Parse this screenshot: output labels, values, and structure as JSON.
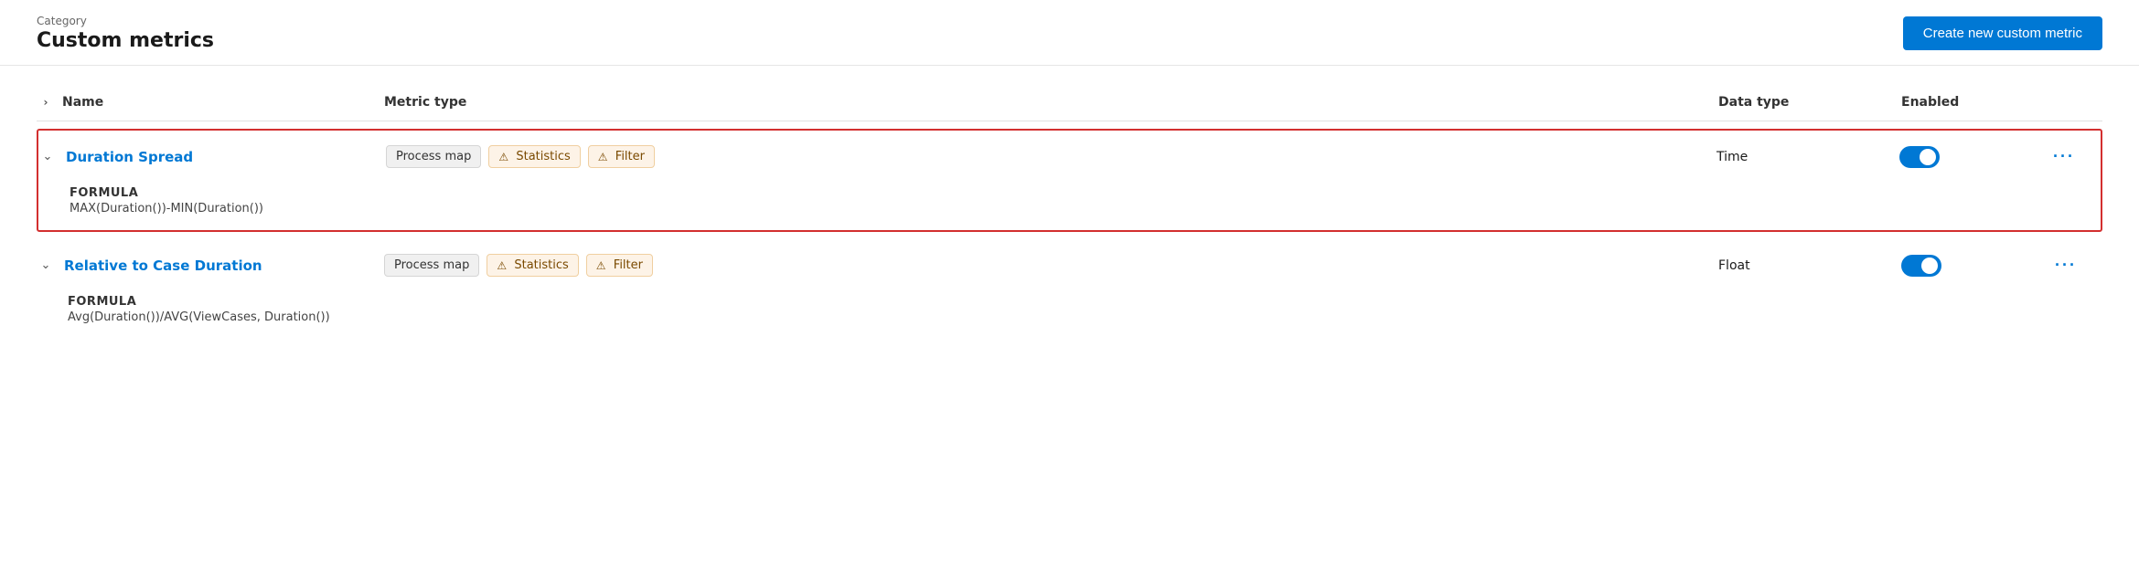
{
  "header": {
    "category_label": "Category",
    "page_title": "Custom metrics",
    "create_btn_label": "Create new custom metric"
  },
  "table": {
    "columns": {
      "expand_icon": "›",
      "name": "Name",
      "metric_type": "Metric type",
      "data_type": "Data type",
      "enabled": "Enabled"
    },
    "rows": [
      {
        "id": "duration-spread",
        "name": "Duration Spread",
        "expanded": true,
        "highlighted": true,
        "metric_types": [
          {
            "label": "Process map",
            "style": "gray"
          },
          {
            "label": "Statistics",
            "style": "orange",
            "has_warning": true
          },
          {
            "label": "Filter",
            "style": "orange",
            "has_warning": true
          }
        ],
        "data_type": "Time",
        "enabled": true,
        "formula_label": "FORMULA",
        "formula_value": "MAX(Duration())-MIN(Duration())"
      },
      {
        "id": "relative-to-case-duration",
        "name": "Relative to Case Duration",
        "expanded": true,
        "highlighted": false,
        "metric_types": [
          {
            "label": "Process map",
            "style": "gray"
          },
          {
            "label": "Statistics",
            "style": "orange",
            "has_warning": true
          },
          {
            "label": "Filter",
            "style": "orange",
            "has_warning": true
          }
        ],
        "data_type": "Float",
        "enabled": true,
        "formula_label": "FORMULA",
        "formula_value": "Avg(Duration())/AVG(ViewCases, Duration())"
      }
    ],
    "warning_char": "⚠"
  }
}
